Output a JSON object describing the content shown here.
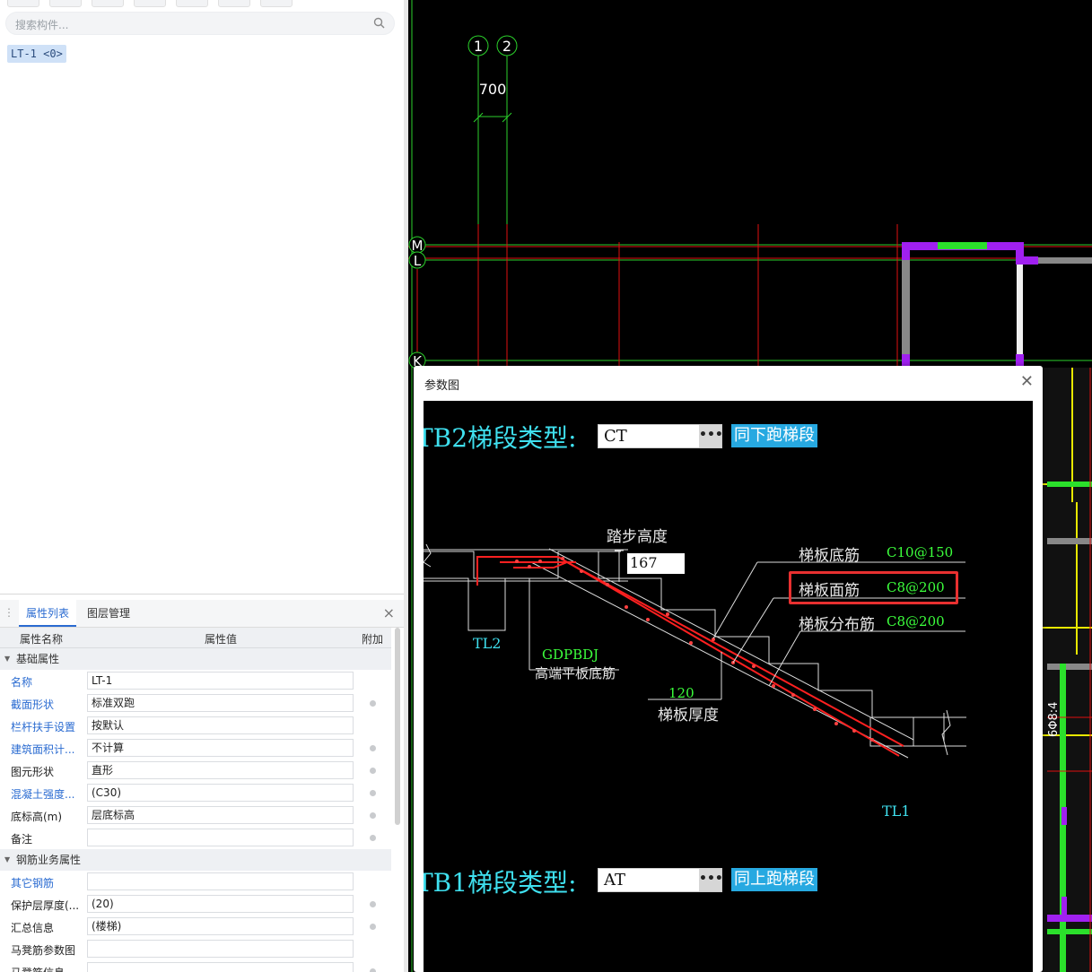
{
  "left_panel": {
    "search": {
      "placeholder": "搜索构件..."
    },
    "tree": {
      "selected_item": "LT-1 <0>"
    },
    "tabs": [
      {
        "label": "属性列表"
      },
      {
        "label": "图层管理"
      }
    ],
    "grid": {
      "col_name": "属性名称",
      "col_value": "属性值",
      "col_extra": "附加",
      "groups": [
        {
          "label": "基础属性"
        },
        {
          "label": "钢筋业务属性"
        }
      ],
      "rows": [
        {
          "name": "名称",
          "value": "LT-1"
        },
        {
          "name": "截面形状",
          "value": "标准双跑"
        },
        {
          "name": "栏杆扶手设置",
          "value": "按默认"
        },
        {
          "name": "建筑面积计...",
          "value": "不计算"
        },
        {
          "name": "图元形状",
          "value": "直形"
        },
        {
          "name": "混凝土强度...",
          "value": "(C30)"
        },
        {
          "name": "底标高(m)",
          "value": "层底标高"
        },
        {
          "name": "备注",
          "value": ""
        },
        {
          "name": "其它钢筋",
          "value": ""
        },
        {
          "name": "保护层厚度(...",
          "value": "(20)"
        },
        {
          "name": "汇总信息",
          "value": "(楼梯)"
        },
        {
          "name": "马凳筋参数图",
          "value": ""
        },
        {
          "name": "马凳筋信息",
          "value": ""
        }
      ]
    }
  },
  "cad": {
    "axis_labels": [
      "1",
      "2",
      "M",
      "L",
      "K"
    ],
    "dimension": "700",
    "side_text": "6Φ8:4"
  },
  "dialog": {
    "title": "参数图",
    "close_icon": "close-icon",
    "tb2": {
      "label": "TB2梯段类型:",
      "value": "CT",
      "button": "同下跑梯段"
    },
    "tb1": {
      "label": "TB1梯段类型:",
      "value": "AT",
      "button": "同上跑梯段"
    },
    "drawing": {
      "step_height_label": "踏步高度",
      "step_height_value": "167",
      "bottom_rebar_label": "梯板底筋",
      "bottom_rebar_value": "C10@150",
      "top_rebar_label": "梯板面筋",
      "top_rebar_value": "C8@200",
      "dist_rebar_label": "梯板分布筋",
      "dist_rebar_value": "C8@200",
      "tl2": "TL2",
      "tl1": "TL1",
      "gdpbdj": "GDPBDJ",
      "gdpbdj_desc": "高端平板底筋",
      "thickness_value": "120",
      "thickness_label": "梯板厚度"
    }
  }
}
